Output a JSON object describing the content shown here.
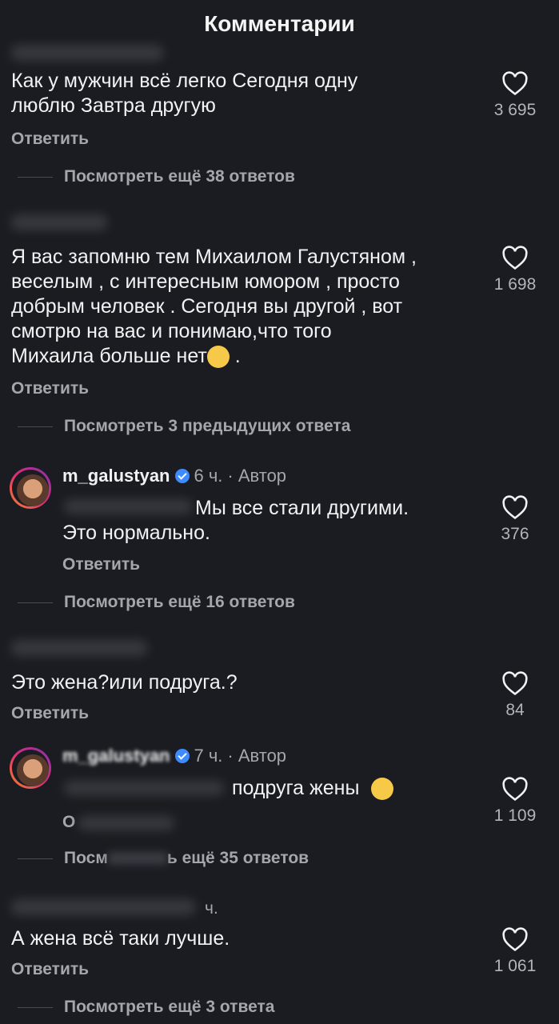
{
  "header": {
    "title": "Комментарии"
  },
  "comments": [
    {
      "text_lines": [
        "Как у мужчин всё легко Сегодня одну",
        "люблю Завтра другую"
      ],
      "reply_label": "Ответить",
      "likes": "3 695",
      "more_label": "Посмотреть ещё 38 ответов"
    },
    {
      "text_lines": [
        "Я вас запомню тем Михаилом Галустяном ,",
        "веселым , с интересным юмором , просто",
        "добрым человек . Сегодня вы другой , вот",
        "смотрю на вас и понимаю,что того",
        "Михаила больше нет",
        " ."
      ],
      "reply_label": "Ответить",
      "likes": "1 698",
      "more_label": "Посмотреть 3 предыдущих ответа"
    },
    {
      "author": "m_galustyan",
      "time": "6 ч.",
      "author_tag": "· Автор",
      "text_lines": [
        "Мы все стали другими.",
        "Это нормально."
      ],
      "reply_label": "Ответить",
      "likes": "376",
      "more_label": "Посмотреть ещё 16 ответов"
    },
    {
      "text_lines": [
        "Это жена?или подруга.?"
      ],
      "reply_label": "Ответить",
      "likes": "84"
    },
    {
      "author": "m_galustyan",
      "time": "7 ч.",
      "author_tag": "· Автор",
      "text_lines": [
        "подруга жены"
      ],
      "reply_label": "О",
      "likes": "1 109",
      "more_label_a": "Посм",
      "more_label_b": "ь ещё 35 ответов"
    },
    {
      "time": "ч.",
      "text_lines": [
        "А жена всё таки лучше."
      ],
      "reply_label": "Ответить",
      "likes": "1 061",
      "more_label": "Посмотреть ещё 3 ответа"
    }
  ],
  "icons": {
    "like": "heart-outline-icon",
    "verified": "verified-badge-icon",
    "avatar": "avatar"
  }
}
